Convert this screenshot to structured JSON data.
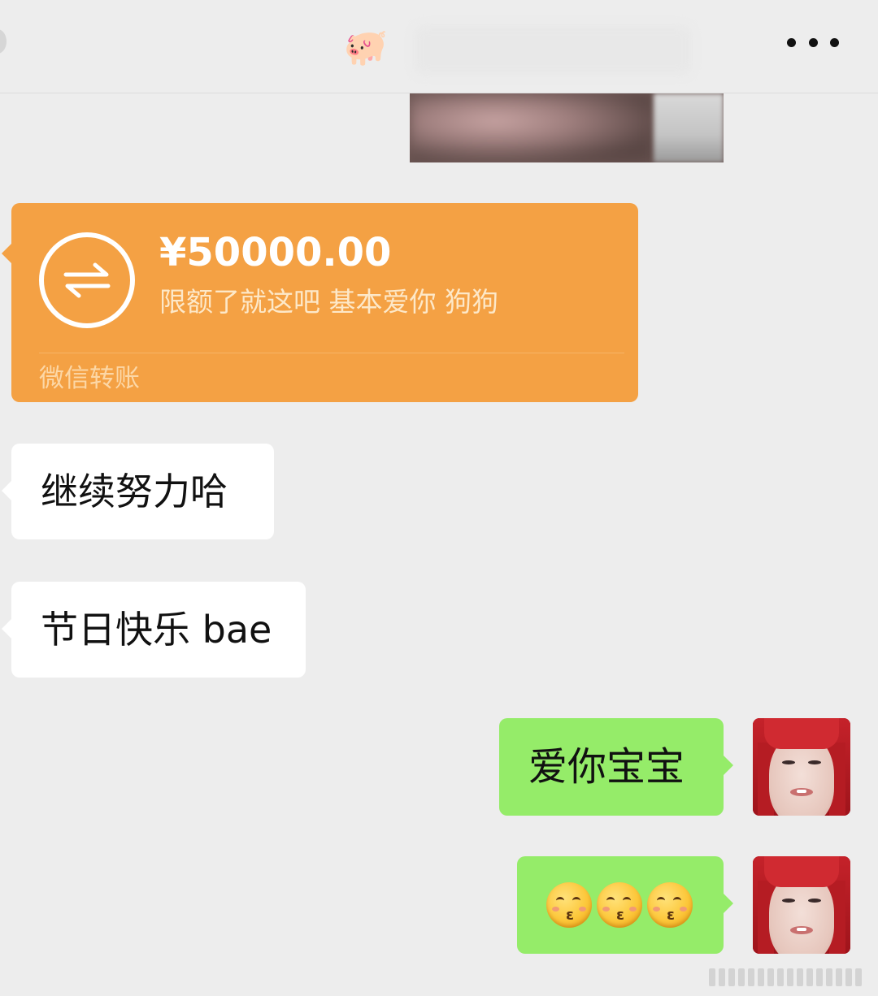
{
  "header": {
    "title": "🐖",
    "more_icon": "more-dots-icon"
  },
  "messages": {
    "transfer": {
      "amount": "¥50000.00",
      "note": "限额了就这吧 基本爱你 狗狗",
      "label": "微信转账",
      "icon": "transfer-arrows-icon",
      "color": "#f4a144"
    },
    "incoming": [
      {
        "text": "继续努力哈"
      },
      {
        "text": "节日快乐 bae"
      }
    ],
    "outgoing": [
      {
        "text": "爱你宝宝"
      },
      {
        "emoji": [
          "kissing-smiling-eyes",
          "kissing-smiling-eyes",
          "kissing-smiling-eyes"
        ]
      }
    ]
  },
  "colors": {
    "background": "#ededed",
    "incoming_bubble": "#ffffff",
    "outgoing_bubble": "#95ec69",
    "transfer_card": "#f4a144"
  }
}
